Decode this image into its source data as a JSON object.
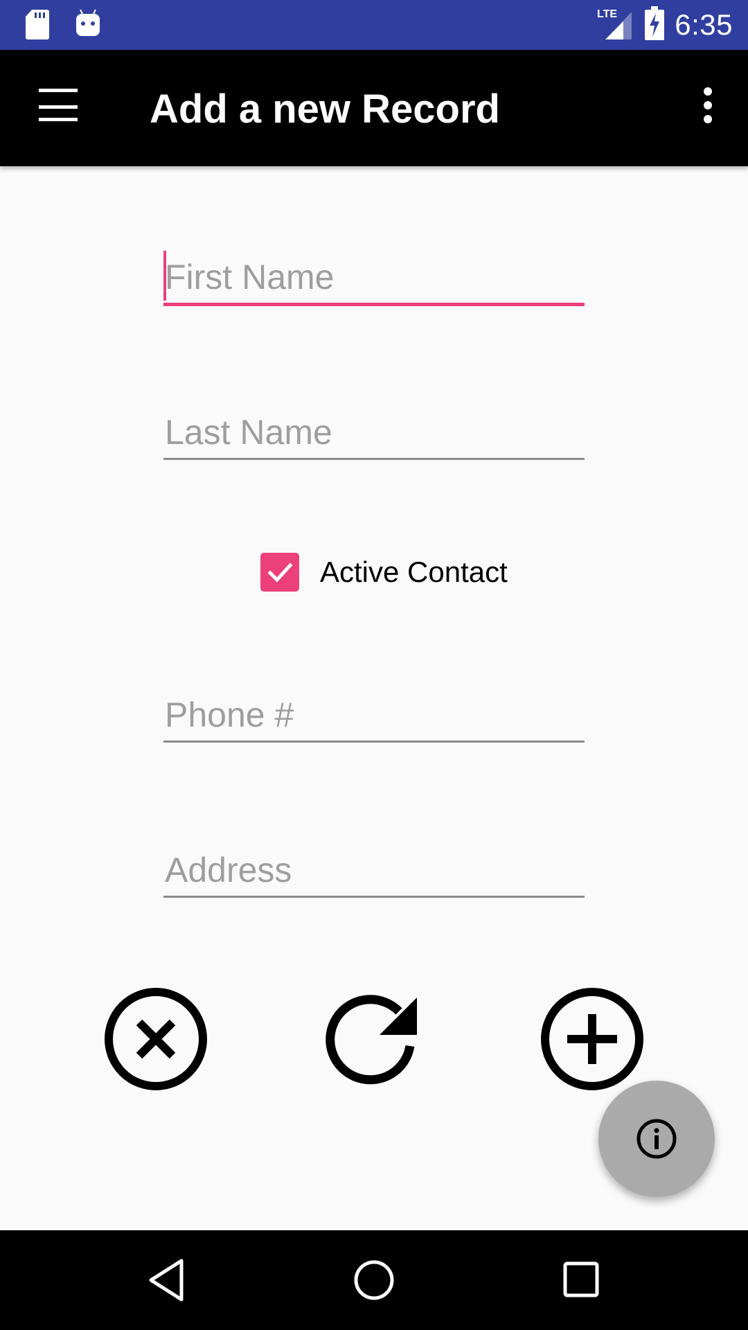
{
  "status_bar": {
    "time": "6:35",
    "network": "LTE",
    "icons": [
      "sd-card-icon",
      "android-icon",
      "signal-icon",
      "battery-charging-icon"
    ]
  },
  "app_bar": {
    "title": "Add a new Record",
    "menu_icon": "menu-icon",
    "overflow_icon": "more-vert-icon"
  },
  "form": {
    "first_name": {
      "placeholder": "First Name",
      "value": ""
    },
    "last_name": {
      "placeholder": "Last Name",
      "value": ""
    },
    "active_contact": {
      "label": "Active Contact",
      "checked": true
    },
    "phone": {
      "placeholder": "Phone #",
      "value": ""
    },
    "address": {
      "placeholder": "Address",
      "value": ""
    }
  },
  "actions": {
    "cancel_icon": "cancel-icon",
    "reset_icon": "refresh-icon",
    "add_icon": "add-circle-icon",
    "info_icon": "info-icon"
  },
  "colors": {
    "status_bar": "#303f9f",
    "app_bar": "#000000",
    "accent": "#ec407a",
    "fab": "#aaaaaa"
  }
}
